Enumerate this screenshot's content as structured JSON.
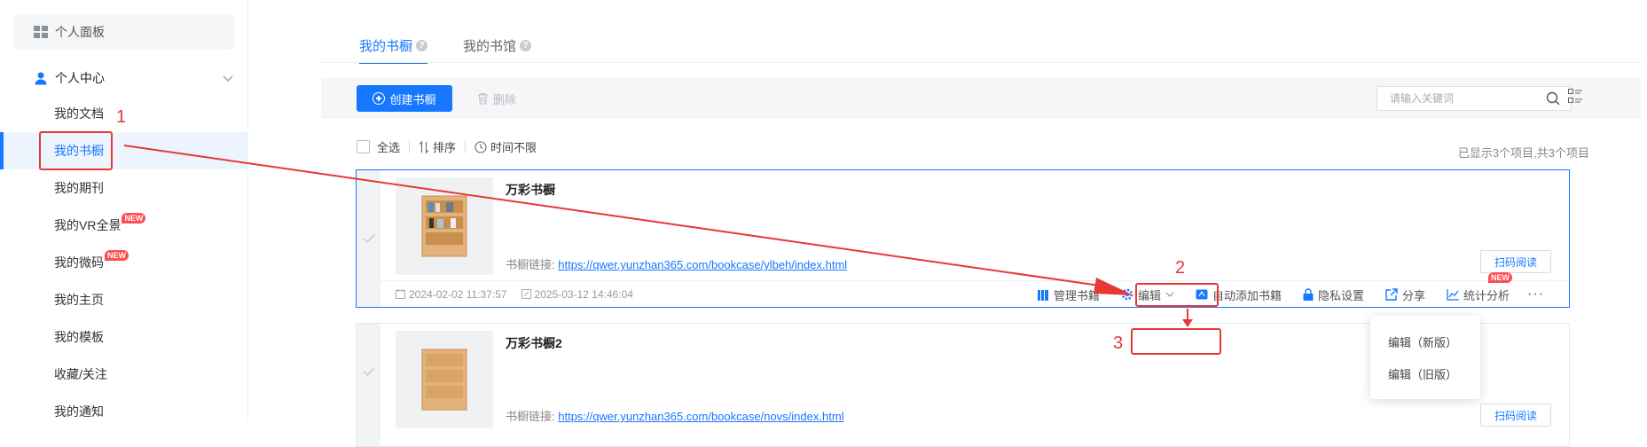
{
  "sidebar": {
    "panel_label": "个人面板",
    "section_label": "个人中心",
    "items": [
      {
        "label": "我的文档",
        "badge": ""
      },
      {
        "label": "我的书橱",
        "badge": ""
      },
      {
        "label": "我的期刊",
        "badge": ""
      },
      {
        "label": "我的VR全景",
        "badge": "NEW"
      },
      {
        "label": "我的微码",
        "badge": "NEW"
      },
      {
        "label": "我的主页",
        "badge": ""
      },
      {
        "label": "我的模板",
        "badge": ""
      },
      {
        "label": "收藏/关注",
        "badge": ""
      },
      {
        "label": "我的通知",
        "badge": ""
      }
    ],
    "active_index": 1
  },
  "tabs": [
    {
      "label": "我的书橱",
      "active": true
    },
    {
      "label": "我的书馆",
      "active": false
    }
  ],
  "toolbar": {
    "create_label": "创建书橱",
    "delete_label": "删除",
    "search_placeholder": "请输入关键词"
  },
  "filters": {
    "select_all": "全选",
    "sort": "排序",
    "time": "时间不限"
  },
  "count_info": "已显示3个项目,共3个项目",
  "cards": [
    {
      "title": "万彩书橱",
      "link_label": "书橱链接:",
      "link": "https://qwer.yunzhan365.com/bookcase/ylbeh/index.html",
      "scan_label": "扫码阅读",
      "created": "2024-02-02 11:37:57",
      "modified": "2025-03-12 14:46:04"
    },
    {
      "title": "万彩书橱2",
      "link_label": "书橱链接:",
      "link": "https://qwer.yunzhan365.com/bookcase/novs/index.html",
      "scan_label": "扫码阅读"
    }
  ],
  "actions": {
    "manage": "管理书籍",
    "edit": "编辑",
    "auto_add": "自动添加书籍",
    "privacy": "隐私设置",
    "share": "分享",
    "stats": "统计分析",
    "stats_badge": "NEW",
    "more": "···"
  },
  "dropdown": {
    "new_version": "编辑（新版）",
    "old_version": "编辑（旧版）"
  },
  "annotations": {
    "n1": "1",
    "n2": "2",
    "n3": "3",
    "color": "#e53935"
  },
  "colors": {
    "accent": "#1677ff",
    "annotation": "#e53935",
    "badge": "#ff4d4f"
  }
}
